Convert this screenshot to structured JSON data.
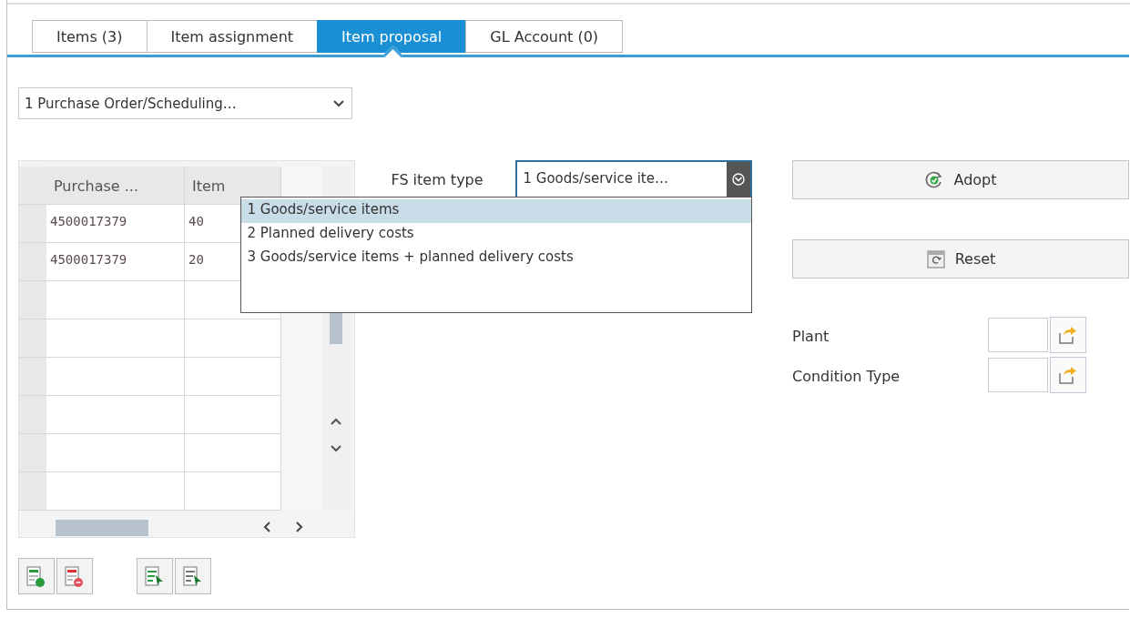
{
  "tabs": [
    {
      "label": "Items (3)",
      "selected": false
    },
    {
      "label": "Item assignment",
      "selected": false
    },
    {
      "label": "Item proposal",
      "selected": true
    },
    {
      "label": "GL Account (0)",
      "selected": false
    }
  ],
  "document_type": {
    "value": "1 Purchase Order/Scheduling…"
  },
  "table": {
    "columns": [
      "Purchase ...",
      "Item"
    ],
    "rows": [
      [
        "4500017379",
        "40"
      ],
      [
        "4500017379",
        "20"
      ]
    ]
  },
  "fs_item_type": {
    "label": "FS item type",
    "value": "1 Goods/service ite…",
    "expanded": true,
    "options": [
      {
        "label": "1 Goods/service items",
        "selected": true
      },
      {
        "label": "2 Planned delivery costs",
        "selected": false
      },
      {
        "label": "3 Goods/service items + planned delivery costs",
        "selected": false
      }
    ]
  },
  "buttons": [
    {
      "label": "Adopt",
      "kind": "adopt"
    },
    {
      "label": "Reset",
      "kind": "reset"
    }
  ],
  "fields": [
    {
      "label": "Plant"
    },
    {
      "label": "Condition Type"
    }
  ]
}
